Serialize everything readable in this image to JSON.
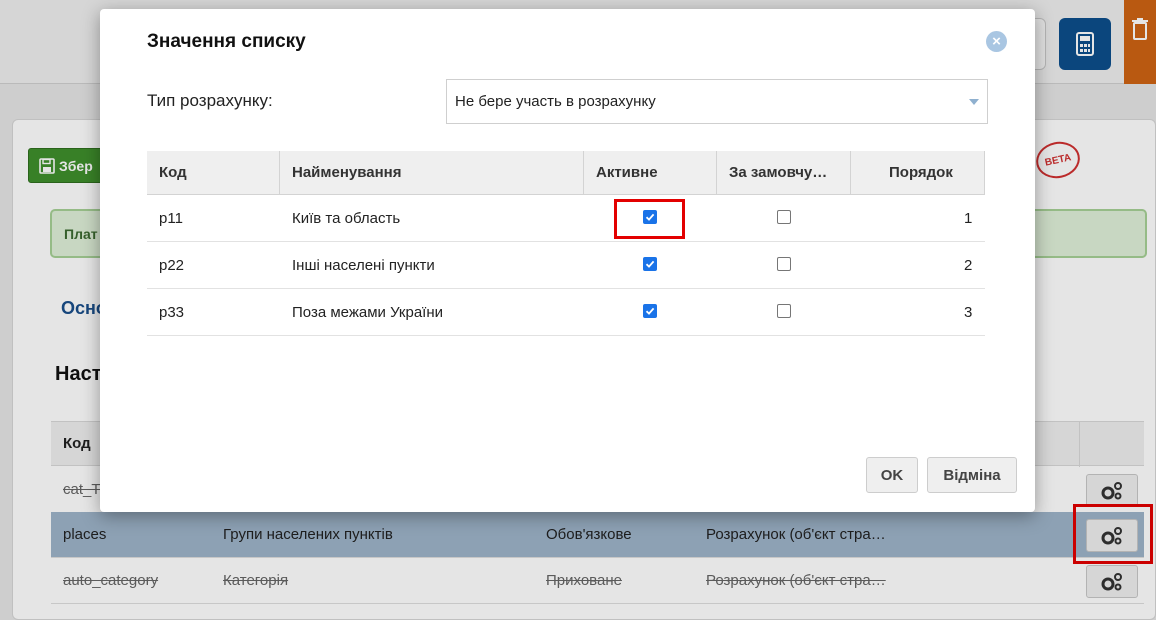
{
  "background": {
    "save_button_label": "Збер",
    "beta_badge": "BETA",
    "alert_text": "Плат",
    "tab_label": "Осно",
    "section_heading": "Наст",
    "table_header_code": "Код",
    "rows": [
      {
        "code": "cat_T",
        "name": "",
        "required": "",
        "calc": "",
        "strike": true,
        "selected": false
      },
      {
        "code": "places",
        "name": "Групи населених пунктів",
        "required": "Обов'язкове",
        "calc": "Розрахунок (об'єкт стра…",
        "strike": false,
        "selected": true
      },
      {
        "code": "auto_category",
        "name": "Категорія",
        "required": "Приховане",
        "calc": "Розрахунок (об'єкт стра…",
        "strike": true,
        "selected": false
      }
    ]
  },
  "modal": {
    "title": "Значення списку",
    "calc_type_label": "Тип розрахунку:",
    "calc_type_value": "Не бере участь в розрахунку",
    "columns": [
      "Код",
      "Найменування",
      "Активне",
      "За замовчу…",
      "Порядок"
    ],
    "rows": [
      {
        "code": "p11",
        "name": "Київ та область",
        "active": true,
        "default": false,
        "order": "1"
      },
      {
        "code": "p22",
        "name": "Інші населені пункти",
        "active": true,
        "default": false,
        "order": "2"
      },
      {
        "code": "p33",
        "name": "Поза межами України",
        "active": true,
        "default": false,
        "order": "3"
      }
    ],
    "ok_label": "OK",
    "cancel_label": "Відміна"
  },
  "colors": {
    "accent_blue": "#0d4e8c",
    "selected_row": "#9eb4c9",
    "highlight_red": "#e30000",
    "save_green": "#3f8f2c"
  }
}
